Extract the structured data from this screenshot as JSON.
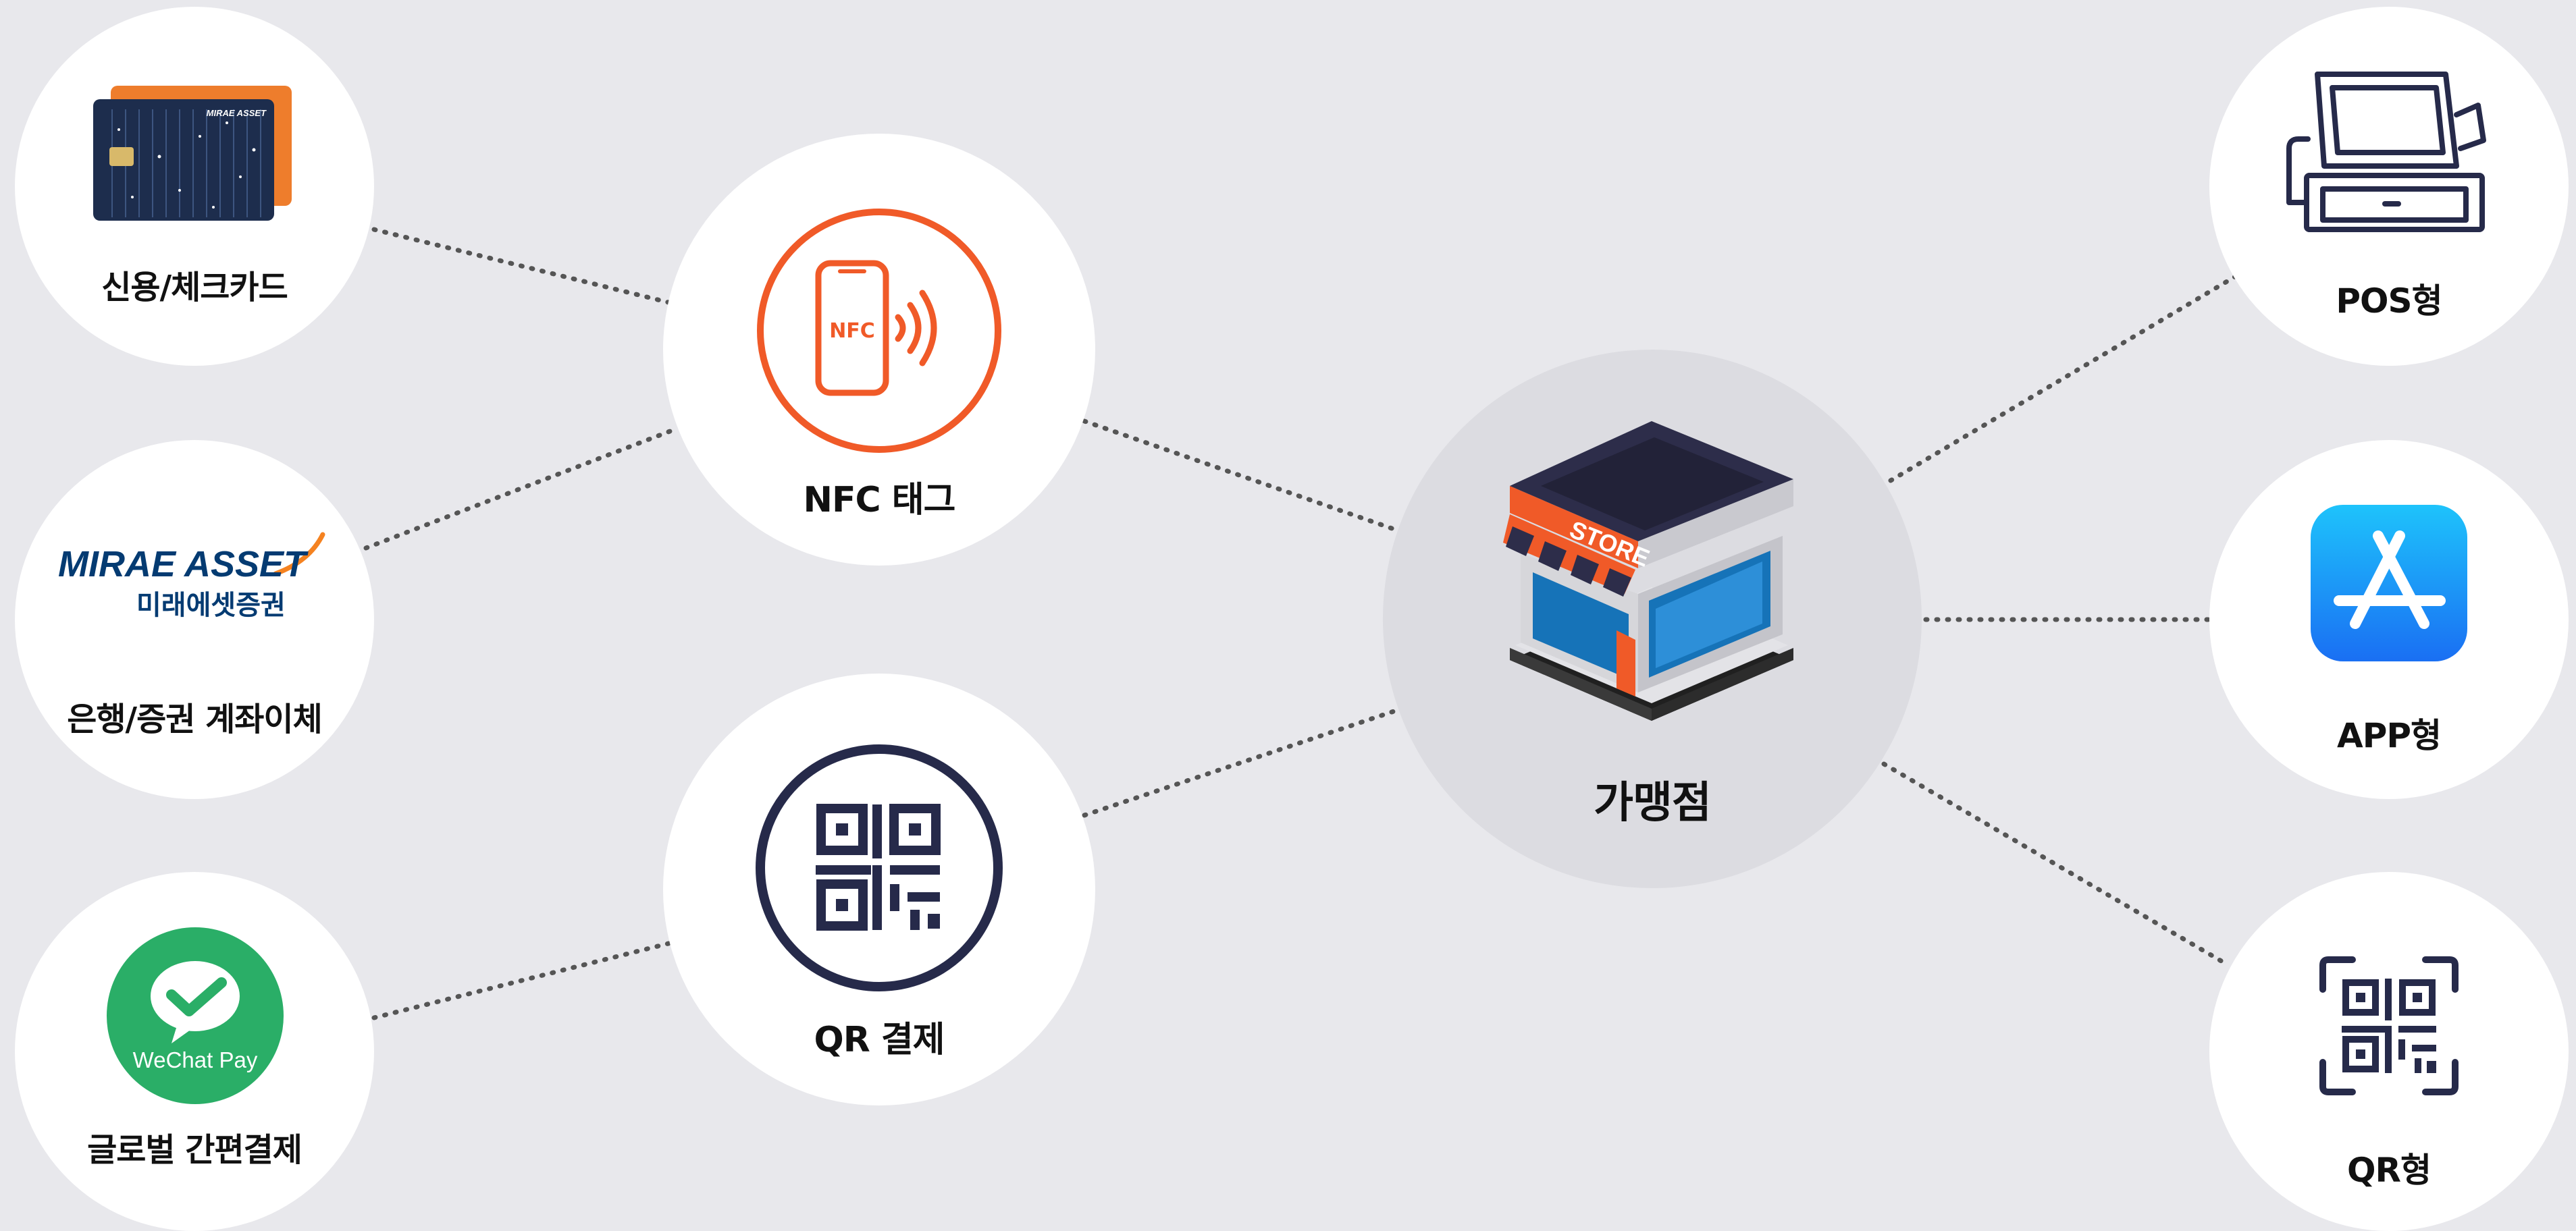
{
  "center": {
    "label": "가맹점",
    "sign_text": "STORE"
  },
  "left_nodes": [
    {
      "label": "신용/체크카드",
      "icon": "credit-card-icon",
      "card_brand_text": "MIRAE ASSET"
    },
    {
      "label": "은행/증권 계좌이체",
      "icon": "mirae-asset-logo",
      "logo_text": "MIRAE ASSET",
      "logo_subtext": "미래에셋증권"
    },
    {
      "label": "글로벌 간편결제",
      "icon": "wechat-pay-icon",
      "logo_text": "WeChat Pay"
    }
  ],
  "middle_nodes": [
    {
      "label": "NFC 태그",
      "icon": "nfc-phone-icon",
      "icon_text": "NFC"
    },
    {
      "label": "QR 결제",
      "icon": "qr-code-icon"
    }
  ],
  "right_nodes": [
    {
      "label": "POS형",
      "icon": "pos-terminal-icon"
    },
    {
      "label": "APP형",
      "icon": "app-store-icon"
    },
    {
      "label": "QR형",
      "icon": "qr-scan-icon"
    }
  ],
  "colors": {
    "background": "#e8e8ec",
    "node": "#ffffff",
    "center_node": "#dcdce1",
    "nfc_accent": "#f05a28",
    "qr_navy": "#262a4a",
    "wechat_green": "#2aae67",
    "mirae_navy": "#043b72",
    "mirae_orange": "#f58220",
    "app_blue": "#1a8cf5",
    "connector": "#555555"
  }
}
